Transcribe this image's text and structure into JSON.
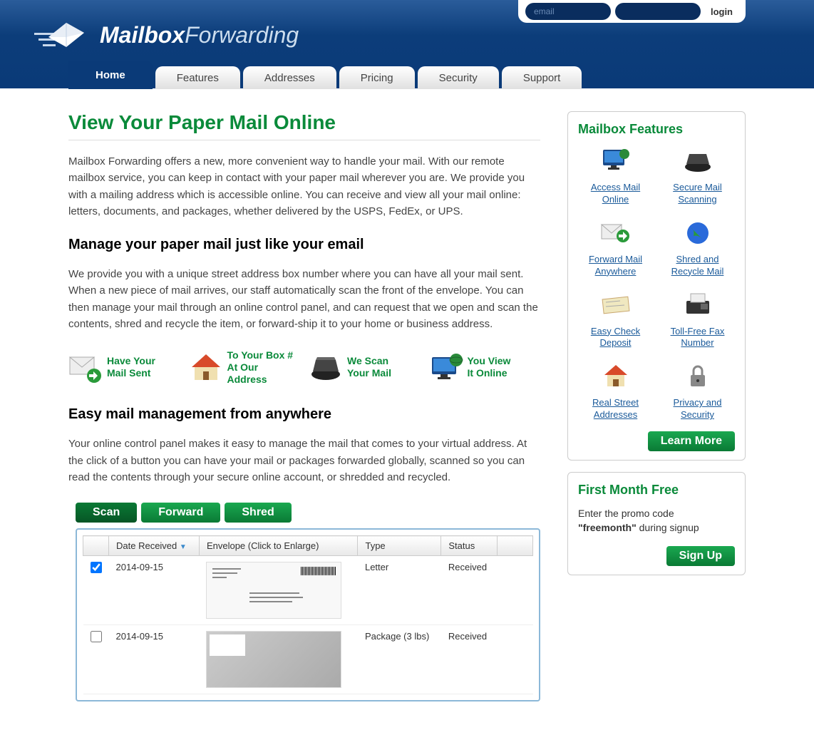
{
  "login": {
    "email_placeholder": "email",
    "button": "login"
  },
  "logo": {
    "bold": "Mailbox",
    "light": "Forwarding"
  },
  "nav": [
    "Home",
    "Features",
    "Addresses",
    "Pricing",
    "Security",
    "Support"
  ],
  "page": {
    "h1": "View Your Paper Mail Online",
    "p1": "Mailbox Forwarding offers a new, more convenient way to handle your mail. With our remote mailbox service, you can keep in contact with your paper mail wherever you are. We provide you with a mailing address which is accessible online. You can receive and view all your mail online: letters, documents, and packages, whether delivered by the USPS, FedEx, or UPS.",
    "h2a": "Manage your paper mail just like your email",
    "p2": "We provide you with a unique street address box number where you can have all your mail sent. When a new piece of mail arrives, our staff automatically scan the front of the envelope. You can then manage your mail through an online control panel, and can request that we open and scan the contents, shred and recycle the item, or forward-ship it to your home or business address.",
    "steps": [
      {
        "l1": "Have Your",
        "l2": "Mail Sent"
      },
      {
        "l1": "To Your Box #",
        "l2": "At Our Address"
      },
      {
        "l1": "We Scan",
        "l2": "Your Mail"
      },
      {
        "l1": "You View",
        "l2": "It Online"
      }
    ],
    "h2b": "Easy mail management from anywhere",
    "p3": "Your online control panel makes it easy to manage the mail that comes to your virtual address. At the click of a button you can have your mail or packages forwarded globally, scanned so you can read the contents through your secure online account, or shredded and recycled."
  },
  "actions": {
    "scan": "Scan",
    "forward": "Forward",
    "shred": "Shred"
  },
  "table": {
    "headers": {
      "date": "Date Received",
      "env": "Envelope (Click to Enlarge)",
      "type": "Type",
      "status": "Status"
    },
    "rows": [
      {
        "checked": true,
        "date": "2014-09-15",
        "type": "Letter",
        "status": "Received"
      },
      {
        "checked": false,
        "date": "2014-09-15",
        "type": "Package (3 lbs)",
        "status": "Received"
      }
    ]
  },
  "sidebar": {
    "features_title": "Mailbox Features",
    "features": [
      "Access Mail Online",
      "Secure Mail Scanning",
      "Forward Mail Anywhere",
      "Shred and Recycle Mail",
      "Easy Check Deposit",
      "Toll-Free Fax Number",
      "Real Street Addresses",
      "Privacy and Security"
    ],
    "learn_more": "Learn More",
    "promo_title": "First Month Free",
    "promo_intro": "Enter the promo code",
    "promo_code": "\"freemonth\"",
    "promo_suffix": " during signup",
    "signup": "Sign Up"
  }
}
